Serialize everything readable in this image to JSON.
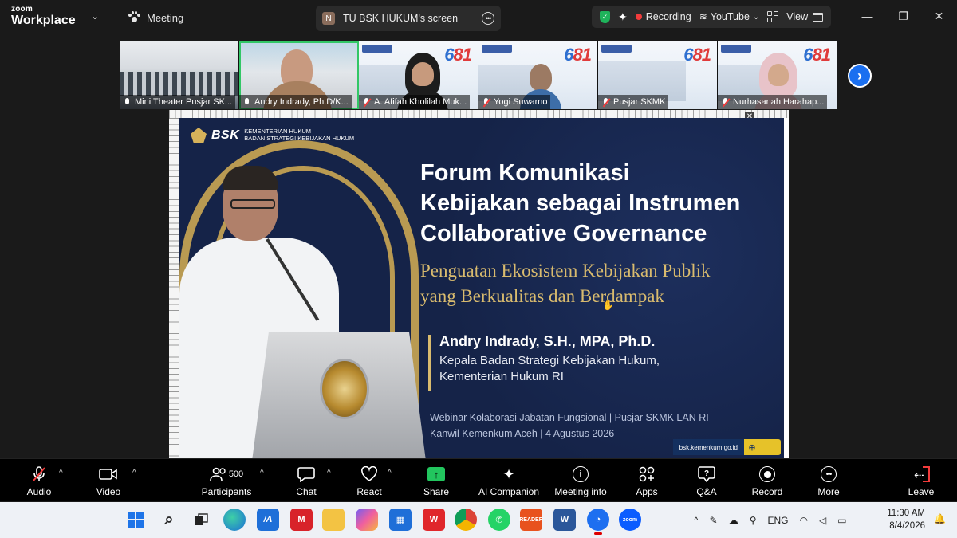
{
  "app": {
    "logo_small": "zoom",
    "logo_big": "Workplace",
    "meeting_label": "Meeting"
  },
  "screen_tab": {
    "avatar_letter": "N",
    "title": "TU BSK HUKUM's screen"
  },
  "status": {
    "recording_label": "Recording",
    "youtube_label": "YouTube",
    "view_label": "View",
    "accent_green": "#1fb35b",
    "recording_red": "#f23b3b"
  },
  "participants": [
    {
      "name": "Mini Theater Pusjar SK...",
      "muted": false,
      "active": false
    },
    {
      "name": "Andry Indrady, Ph.D/K...",
      "muted": false,
      "active": true
    },
    {
      "name": "A. Afifah Kholilah Muk...",
      "muted": true,
      "active": false
    },
    {
      "name": "Yogi Suwarno",
      "muted": true,
      "active": false
    },
    {
      "name": "Pusjar SKMK",
      "muted": true,
      "active": false
    },
    {
      "name": "Nurhasanah Harahap...",
      "muted": true,
      "active": false
    }
  ],
  "poster_number": {
    "a": "6",
    "b": "81"
  },
  "slide": {
    "bsk_logo": "BSK",
    "org_line1": "KEMENTERIAN HUKUM",
    "org_line2": "BADAN STRATEGI KEBIJAKAN HUKUM",
    "title_line1": "Forum Komunikasi",
    "title_line2": "Kebijakan sebagai Instrumen",
    "title_line3": "Collaborative Governance",
    "subtitle_line1": "Penguatan Ekosistem Kebijakan Publik",
    "subtitle_line2": "yang Berkualitas dan Berdampak",
    "speaker_name": "Andry Indrady, S.H., MPA, Ph.D.",
    "speaker_role_line1": "Kepala Badan Strategi Kebijakan Hukum,",
    "speaker_role_line2": "Kementerian Hukum RI",
    "event_line1": "Webinar Kolaborasi Jabatan Fungsional | Pusjar SKMK LAN RI -",
    "event_line2": "Kanwil Kemenkum Aceh | 4 Agustus 2026",
    "url": "bsk.kemenkum.go.id",
    "gold": "#d9bb6e",
    "navy": "#152348"
  },
  "toolbar": {
    "audio": "Audio",
    "video": "Video",
    "participants": "Participants",
    "participants_count": "500",
    "chat": "Chat",
    "react": "React",
    "share": "Share",
    "ai_companion": "AI Companion",
    "meeting_info": "Meeting info",
    "apps": "Apps",
    "qa": "Q&A",
    "record": "Record",
    "more": "More",
    "leave": "Leave"
  },
  "taskbar": {
    "language": "ENG",
    "time": "11:30 AM",
    "date": "8/4/2026",
    "reader_label": "READER",
    "zoom_label": "zoom",
    "word_label": "W"
  }
}
